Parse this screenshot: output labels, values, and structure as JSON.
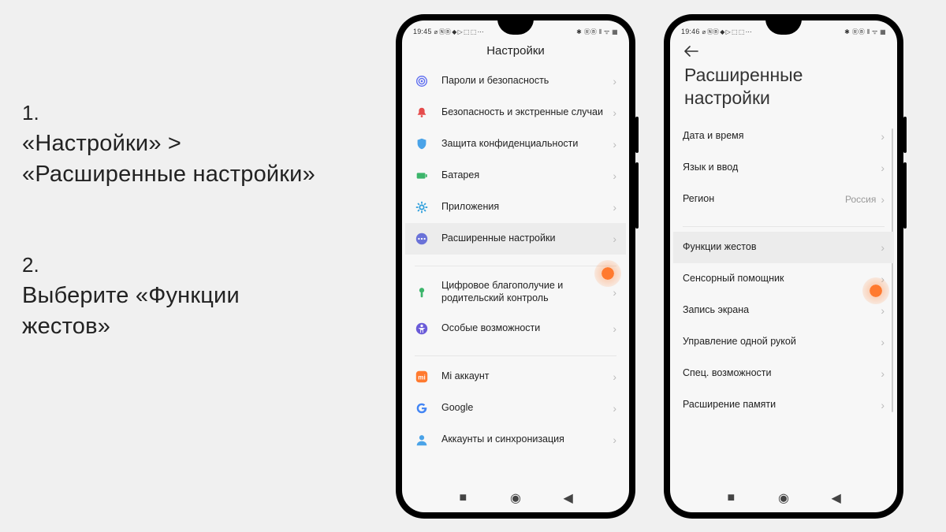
{
  "instructions": {
    "step1_num": "1.",
    "step1_text": "«Настройки» > «Расширенные настройки»",
    "step2_num": "2.",
    "step2_text": "Выберите «Функции жестов»"
  },
  "phone1": {
    "status": {
      "time": "19:45",
      "left_icons": "⌀ ⓃⒷ ◆ ▷ ⬚ ⬚ ⋯",
      "right_icons": "✱ ⓇⒷ ⫴ ᯤ ▦"
    },
    "title": "Настройки",
    "rows": [
      {
        "label": "Пароли и безопасность",
        "icon": "fingerprint",
        "color": "#5b6bf0"
      },
      {
        "label": "Безопасность и экстренные случаи",
        "icon": "bell",
        "color": "#e54b4b"
      },
      {
        "label": "Защита конфиденциальности",
        "icon": "shield",
        "color": "#4aa3e8"
      },
      {
        "label": "Батарея",
        "icon": "battery",
        "color": "#3cb56b"
      },
      {
        "label": "Приложения",
        "icon": "gear",
        "color": "#2f9fdc"
      },
      {
        "label": "Расширенные настройки",
        "icon": "dots",
        "color": "#6a72d8",
        "highlighted": true
      },
      {
        "gap": true
      },
      {
        "label": "Цифровое благополучие и родительский контроль",
        "icon": "heart",
        "color": "#3cb56b"
      },
      {
        "label": "Особые возможности",
        "icon": "access",
        "color": "#6a5bd8"
      },
      {
        "gap": true
      },
      {
        "label": "Mi аккаунт",
        "icon": "mi",
        "color": "#ff7a2f"
      },
      {
        "label": "Google",
        "icon": "google",
        "color": "#4285f4"
      },
      {
        "label": "Аккаунты и синхронизация",
        "icon": "person",
        "color": "#4aa3e8"
      }
    ]
  },
  "phone2": {
    "status": {
      "time": "19:46",
      "left_icons": "⌀ ⓃⒷ ◆ ▷ ⬚ ⬚ ⋯",
      "right_icons": "✱ ⓇⒷ ⫴ ᯤ ▦"
    },
    "title": "Расширенные настройки",
    "rows": [
      {
        "label": "Дата и время"
      },
      {
        "label": "Язык и ввод"
      },
      {
        "label": "Регион",
        "value": "Россия"
      },
      {
        "gap": true
      },
      {
        "label": "Функции жестов",
        "highlighted": true
      },
      {
        "label": "Сенсорный помощник"
      },
      {
        "label": "Запись экрана"
      },
      {
        "label": "Управление одной рукой"
      },
      {
        "label": "Спец. возможности"
      },
      {
        "label": "Расширение памяти"
      }
    ]
  }
}
